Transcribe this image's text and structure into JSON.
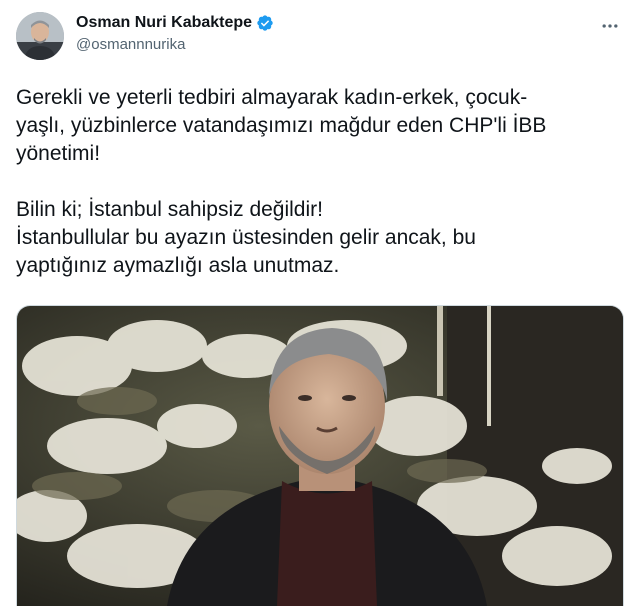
{
  "author": {
    "display_name": "Osman Nuri Kabaktepe",
    "handle": "@osmannnurika",
    "verified": true,
    "avatar_icon": "profile-photo-avatar"
  },
  "menu": {
    "icon": "more-horizontal-icon"
  },
  "tweet": {
    "paragraph1": [
      "Gerekli ve yeterli tedbiri almayarak kadın-erkek, çocuk-",
      "yaşlı, yüzbinlerce vatandaşımızı mağdur eden CHP'li İBB",
      "yönetimi!"
    ],
    "paragraph2": [
      "Bilin ki; İstanbul sahipsiz değildir!",
      "İstanbullular bu ayazın üstesinden gelir ancak, bu",
      "yaptığınız aymazlığı asla unutmaz."
    ]
  },
  "media": {
    "description_icon": "photo-man-snowy-trees-night"
  },
  "colors": {
    "text": "#0f1419",
    "secondary": "#536471",
    "verified_blue": "#1d9bf0",
    "border": "#cfd9de"
  }
}
